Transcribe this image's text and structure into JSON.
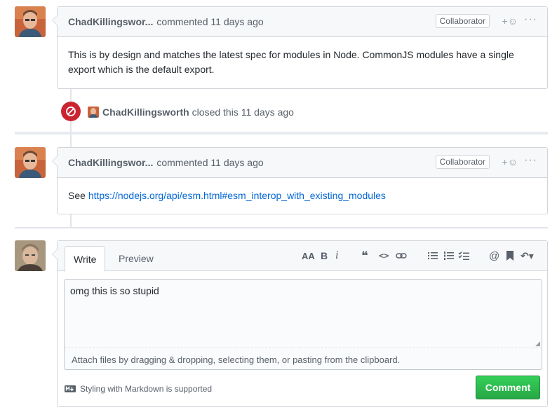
{
  "comments": [
    {
      "author": "ChadKillingswor...",
      "action": "commented 11 days ago",
      "badge": "Collaborator",
      "reaction": "+☺",
      "more": "···",
      "body": "This is by design and matches the latest spec for modules in Node. CommonJS modules have a single export which is the default export."
    },
    {
      "author": "ChadKillingswor...",
      "action": "commented 11 days ago",
      "badge": "Collaborator",
      "reaction": "+☺",
      "more": "···",
      "body_prefix": "See",
      "link": "https://nodejs.org/api/esm.html#esm_interop_with_existing_modules"
    }
  ],
  "event": {
    "author": "ChadKillingsworth",
    "text": "closed this 11 days ago"
  },
  "form": {
    "tabs": {
      "write": "Write",
      "preview": "Preview"
    },
    "toolbar": {
      "heading": "AA",
      "bold": "B",
      "italic": "i",
      "quote": "❝",
      "code": "<>",
      "at": "@",
      "reply": "↶▾"
    },
    "textarea_value": "omg this is so stupid",
    "attach_text": "Attach files by dragging & dropping, selecting them, or pasting from the clipboard.",
    "markdown_note": "Styling with Markdown is supported",
    "submit_label": "Comment"
  },
  "colors": {
    "closed_red": "#cb2431",
    "link_blue": "#0366d6",
    "button_green": "#28a745"
  }
}
